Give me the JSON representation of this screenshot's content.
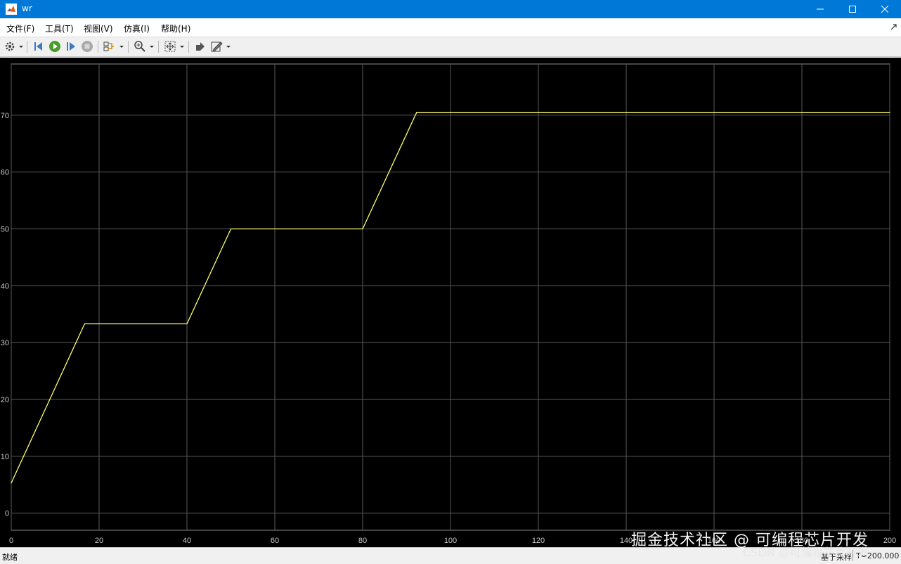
{
  "window": {
    "title": "wr",
    "controls": [
      "minimize-icon",
      "maximize-icon",
      "close-icon"
    ]
  },
  "menu": {
    "items": [
      {
        "label": "文件(F)"
      },
      {
        "label": "工具(T)"
      },
      {
        "label": "视图(V)"
      },
      {
        "label": "仿真(I)"
      },
      {
        "label": "帮助(H)"
      }
    ]
  },
  "toolbar": {
    "buttons": [
      "settings-icon",
      "step-back-icon",
      "run-icon",
      "step-forward-icon",
      "stop-icon",
      "signal-selector-icon",
      "zoom-icon",
      "fit-to-view-icon",
      "highlight-block-icon",
      "style-icon"
    ]
  },
  "colors": {
    "plot_background": "#000000",
    "grid": "#5a5a5a",
    "axis_text": "#c8c8c8",
    "signal": "#ffff66",
    "titlebar": "#0078d7"
  },
  "status": {
    "left": "就绪",
    "middle": "基于采样",
    "right": "T=200.000"
  },
  "watermark": {
    "main": "掘金技术社区 @ 可编程芯片开发",
    "secondary": "CSDN @可编程芯片开发"
  },
  "chart_data": {
    "type": "line",
    "title": "",
    "xlabel": "",
    "ylabel": "",
    "xlim": [
      0,
      200
    ],
    "ylim": [
      -3,
      79
    ],
    "xticks": [
      "0",
      "20",
      "40",
      "60",
      "80",
      "100",
      "120",
      "140",
      "160",
      "180",
      "200"
    ],
    "yticks": [
      "0",
      "10",
      "20",
      "30",
      "40",
      "50",
      "60",
      "70"
    ],
    "grid": true,
    "series": [
      {
        "x": [
          0,
          16.7,
          40,
          50,
          80,
          92.3,
          200
        ],
        "y": [
          5.3,
          33.3,
          33.3,
          50,
          50,
          70.5,
          70.5
        ]
      }
    ]
  }
}
